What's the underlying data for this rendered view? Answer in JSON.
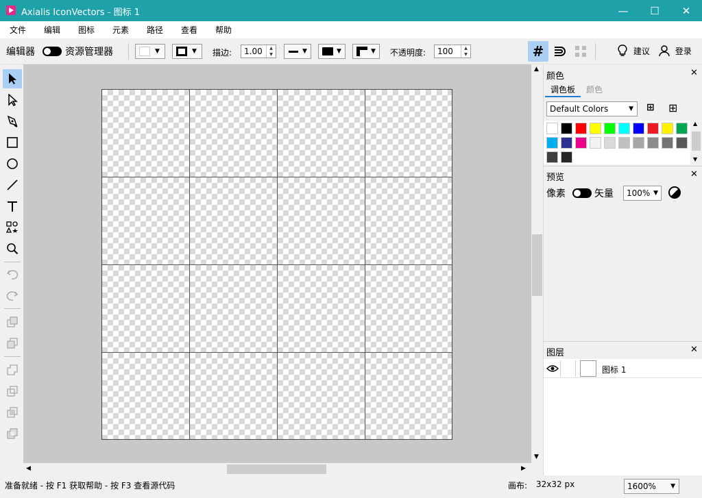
{
  "window": {
    "title": "Axialis IconVectors - 图标 1",
    "minimize": "—",
    "maximize": "☐",
    "close": "✕"
  },
  "menu": [
    "文件",
    "编辑",
    "图标",
    "元素",
    "路径",
    "查看",
    "帮助"
  ],
  "toolbar": {
    "editor_label": "编辑器",
    "manager_label": "资源管理器",
    "stroke_label": "描边:",
    "stroke_value": "1.00",
    "opacity_label": "不透明度:",
    "opacity_value": "100",
    "suggest_label": "建议",
    "login_label": "登录"
  },
  "colors_panel": {
    "title": "颜色",
    "tab_palette": "调色板",
    "tab_color": "颜色",
    "palette_name": "Default Colors",
    "swatches": [
      "#ffffff",
      "#000000",
      "#ff0000",
      "#ffff00",
      "#00ff00",
      "#00ffff",
      "#0000ff",
      "#ed1c24",
      "#fff200",
      "#00a651",
      "#00aeef",
      "#2e3192",
      "#ec008c",
      "#f2f2f2",
      "#d9d9d9",
      "#c0c0c0",
      "#a6a6a6",
      "#8c8c8c",
      "#737373",
      "#595959",
      "#404040",
      "#262626"
    ]
  },
  "preview_panel": {
    "title": "预览",
    "pixel_label": "像素",
    "vector_label": "矢量",
    "zoom_value": "100%"
  },
  "layers_panel": {
    "title": "图层",
    "layers": [
      {
        "name": "图标 1"
      }
    ]
  },
  "status": {
    "message": "准备就绪 - 按 F1 获取帮助 - 按 F3 查看源代码",
    "canvas_label": "画布:",
    "canvas_size": "32x32 px",
    "zoom_value": "1600%"
  },
  "colors": {
    "titlebar": "#1fa1a9",
    "accent": "#a9cff5",
    "canvas_bg": "#c8c8c8"
  }
}
